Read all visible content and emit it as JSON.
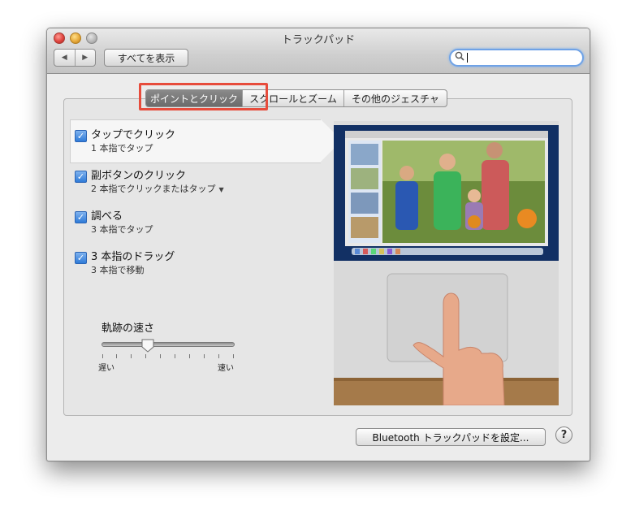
{
  "window": {
    "title": "トラックパッド"
  },
  "toolbar": {
    "show_all_label": "すべてを表示",
    "back_glyph": "◀",
    "forward_glyph": "▶"
  },
  "search": {
    "value": "",
    "placeholder": ""
  },
  "tabs": [
    {
      "label": "ポイントとクリック",
      "selected": true
    },
    {
      "label": "スクロールとズーム",
      "selected": false
    },
    {
      "label": "その他のジェスチャ",
      "selected": false
    }
  ],
  "options": [
    {
      "title": "タップでクリック",
      "subtitle": "1 本指でタップ",
      "checked": true,
      "selected": true
    },
    {
      "title": "副ボタンのクリック",
      "subtitle": "2 本指でクリックまたはタップ",
      "checked": true,
      "has_dropdown": true
    },
    {
      "title": "調べる",
      "subtitle": "3 本指でタップ",
      "checked": true
    },
    {
      "title": "3 本指のドラッグ",
      "subtitle": "3 本指で移動",
      "checked": true
    }
  ],
  "tracking_speed": {
    "label": "軌跡の速さ",
    "min_label": "遅い",
    "max_label": "速い",
    "value_fraction": 0.35
  },
  "footer": {
    "bluetooth_button_label": "Bluetooth トラックパッドを設定...",
    "help_glyph": "?"
  },
  "colors": {
    "highlight": "#e74c3c",
    "checkbox": "#2f7bd8",
    "search_focus": "#6fa2e6"
  }
}
